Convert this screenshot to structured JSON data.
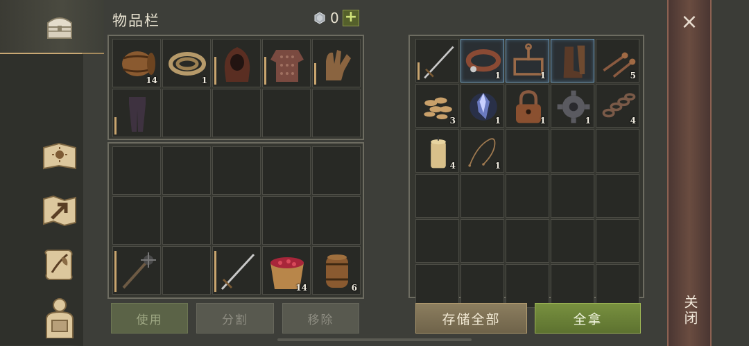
{
  "header": {
    "title": "物品栏",
    "gem_count": "0",
    "plus": "+"
  },
  "sidebar": {
    "items": [
      {
        "name": "chest-icon"
      },
      {
        "name": "sun-book-icon"
      },
      {
        "name": "map-arrow-icon"
      },
      {
        "name": "scroll-quill-icon"
      },
      {
        "name": "character-backpack-icon"
      }
    ]
  },
  "inventory_top": [
    {
      "icon": "barrel",
      "count": "14",
      "dur": 0
    },
    {
      "icon": "rope",
      "count": "1",
      "dur": 0
    },
    {
      "icon": "hood",
      "count": "",
      "dur": 0.65
    },
    {
      "icon": "chainmail",
      "count": "",
      "dur": 0.65
    },
    {
      "icon": "gloves",
      "count": "",
      "dur": 0.5
    },
    {
      "icon": "pants",
      "count": "",
      "dur": 0.4
    },
    {
      "icon": "",
      "count": "",
      "dur": 0
    },
    {
      "icon": "",
      "count": "",
      "dur": 0
    },
    {
      "icon": "",
      "count": "",
      "dur": 0
    },
    {
      "icon": "",
      "count": "",
      "dur": 0
    }
  ],
  "inventory_bottom": [
    {
      "icon": "",
      "count": ""
    },
    {
      "icon": "",
      "count": ""
    },
    {
      "icon": "",
      "count": ""
    },
    {
      "icon": "",
      "count": ""
    },
    {
      "icon": "",
      "count": ""
    },
    {
      "icon": "",
      "count": ""
    },
    {
      "icon": "",
      "count": ""
    },
    {
      "icon": "",
      "count": ""
    },
    {
      "icon": "",
      "count": ""
    },
    {
      "icon": "",
      "count": ""
    },
    {
      "icon": "mace",
      "count": "",
      "dur": 0.95
    },
    {
      "icon": "",
      "count": ""
    },
    {
      "icon": "sword",
      "count": "",
      "dur": 0.95
    },
    {
      "icon": "berry-bucket",
      "count": "14"
    },
    {
      "icon": "barrel-small",
      "count": "6"
    }
  ],
  "storage": [
    {
      "icon": "sword",
      "count": "",
      "dur": 0.45
    },
    {
      "icon": "collar",
      "count": "1",
      "blue": true
    },
    {
      "icon": "trap",
      "count": "1",
      "blue": true
    },
    {
      "icon": "boots",
      "count": "",
      "blue": true
    },
    {
      "icon": "nails",
      "count": "5"
    },
    {
      "icon": "seeds",
      "count": "3"
    },
    {
      "icon": "crystal",
      "count": "1"
    },
    {
      "icon": "padlock",
      "count": "1"
    },
    {
      "icon": "gear",
      "count": "1"
    },
    {
      "icon": "chain",
      "count": "4"
    },
    {
      "icon": "candle",
      "count": "4"
    },
    {
      "icon": "string",
      "count": "1"
    },
    {
      "icon": "",
      "count": ""
    },
    {
      "icon": "",
      "count": ""
    },
    {
      "icon": "",
      "count": ""
    },
    {
      "icon": "",
      "count": ""
    },
    {
      "icon": "",
      "count": ""
    },
    {
      "icon": "",
      "count": ""
    },
    {
      "icon": "",
      "count": ""
    },
    {
      "icon": "",
      "count": ""
    },
    {
      "icon": "",
      "count": ""
    },
    {
      "icon": "",
      "count": ""
    },
    {
      "icon": "",
      "count": ""
    },
    {
      "icon": "",
      "count": ""
    },
    {
      "icon": "",
      "count": ""
    },
    {
      "icon": "",
      "count": ""
    },
    {
      "icon": "",
      "count": ""
    },
    {
      "icon": "",
      "count": ""
    },
    {
      "icon": "",
      "count": ""
    },
    {
      "icon": "",
      "count": ""
    }
  ],
  "buttons": {
    "use": "使用",
    "split": "分割",
    "remove": "移除",
    "store_all": "存储全部",
    "take_all": "全拿"
  },
  "close": {
    "x": "×",
    "label": "关闭"
  }
}
